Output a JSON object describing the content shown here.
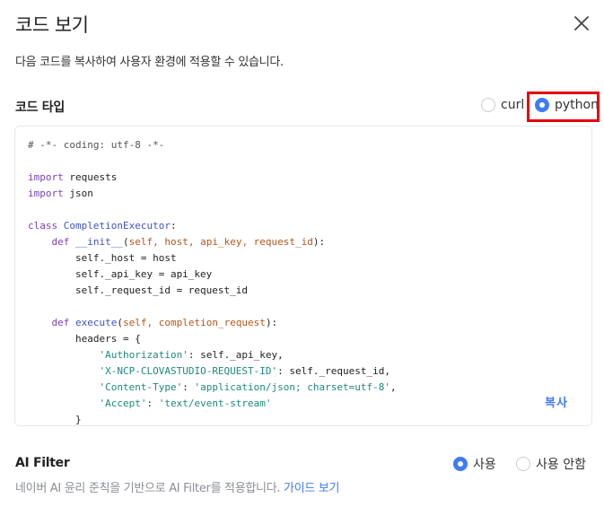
{
  "dialog": {
    "title": "코드 보기",
    "description": "다음 코드를 복사하여 사용자 환경에 적용할 수 있습니다.",
    "close_icon": "close-icon"
  },
  "code_type": {
    "label": "코드 타입",
    "options": [
      {
        "label": "curl",
        "selected": false
      },
      {
        "label": "python",
        "selected": true
      }
    ],
    "highlight_color": "#e8000b"
  },
  "code": {
    "lines": [
      [
        {
          "t": "# -*- coding: utf-8 -*-",
          "c": "c-comment"
        }
      ],
      [],
      [
        {
          "t": "import",
          "c": "c-kw"
        },
        {
          "t": " requests",
          "c": ""
        }
      ],
      [
        {
          "t": "import",
          "c": "c-kw"
        },
        {
          "t": " json",
          "c": ""
        }
      ],
      [],
      [
        {
          "t": "class",
          "c": "c-kw"
        },
        {
          "t": " CompletionExecutor",
          "c": "c-cls"
        },
        {
          "t": ":",
          "c": ""
        }
      ],
      [
        {
          "t": "    ",
          "c": ""
        },
        {
          "t": "def",
          "c": "c-kw"
        },
        {
          "t": " __init__",
          "c": "c-def"
        },
        {
          "t": "(",
          "c": ""
        },
        {
          "t": "self, host, api_key, request_id",
          "c": "c-param"
        },
        {
          "t": "):",
          "c": ""
        }
      ],
      [
        {
          "t": "        self._host = host",
          "c": ""
        }
      ],
      [
        {
          "t": "        self._api_key = api_key",
          "c": ""
        }
      ],
      [
        {
          "t": "        self._request_id = request_id",
          "c": ""
        }
      ],
      [],
      [
        {
          "t": "    ",
          "c": ""
        },
        {
          "t": "def",
          "c": "c-kw"
        },
        {
          "t": " execute",
          "c": "c-def"
        },
        {
          "t": "(",
          "c": ""
        },
        {
          "t": "self, completion_request",
          "c": "c-param"
        },
        {
          "t": "):",
          "c": ""
        }
      ],
      [
        {
          "t": "        headers = {",
          "c": ""
        }
      ],
      [
        {
          "t": "            ",
          "c": ""
        },
        {
          "t": "'Authorization'",
          "c": "c-str"
        },
        {
          "t": ": self._api_key,",
          "c": ""
        }
      ],
      [
        {
          "t": "            ",
          "c": ""
        },
        {
          "t": "'X-NCP-CLOVASTUDIO-REQUEST-ID'",
          "c": "c-str"
        },
        {
          "t": ": self._request_id,",
          "c": ""
        }
      ],
      [
        {
          "t": "            ",
          "c": ""
        },
        {
          "t": "'Content-Type'",
          "c": "c-str"
        },
        {
          "t": ": ",
          "c": ""
        },
        {
          "t": "'application/json; charset=utf-8'",
          "c": "c-str"
        },
        {
          "t": ",",
          "c": ""
        }
      ],
      [
        {
          "t": "            ",
          "c": ""
        },
        {
          "t": "'Accept'",
          "c": "c-str"
        },
        {
          "t": ": ",
          "c": ""
        },
        {
          "t": "'text/event-stream'",
          "c": "c-str"
        }
      ],
      [
        {
          "t": "        }",
          "c": ""
        }
      ]
    ],
    "copy_label": "복사"
  },
  "ai_filter": {
    "label": "AI Filter",
    "options": [
      {
        "label": "사용",
        "selected": true
      },
      {
        "label": "사용 안함",
        "selected": false
      }
    ],
    "description": "네이버 AI 윤리 준칙을 기반으로 AI Filter를 적용합니다.",
    "guide_link": "가이드 보기"
  },
  "colors": {
    "accent": "#3e7bf7",
    "highlight": "#e8000b"
  }
}
